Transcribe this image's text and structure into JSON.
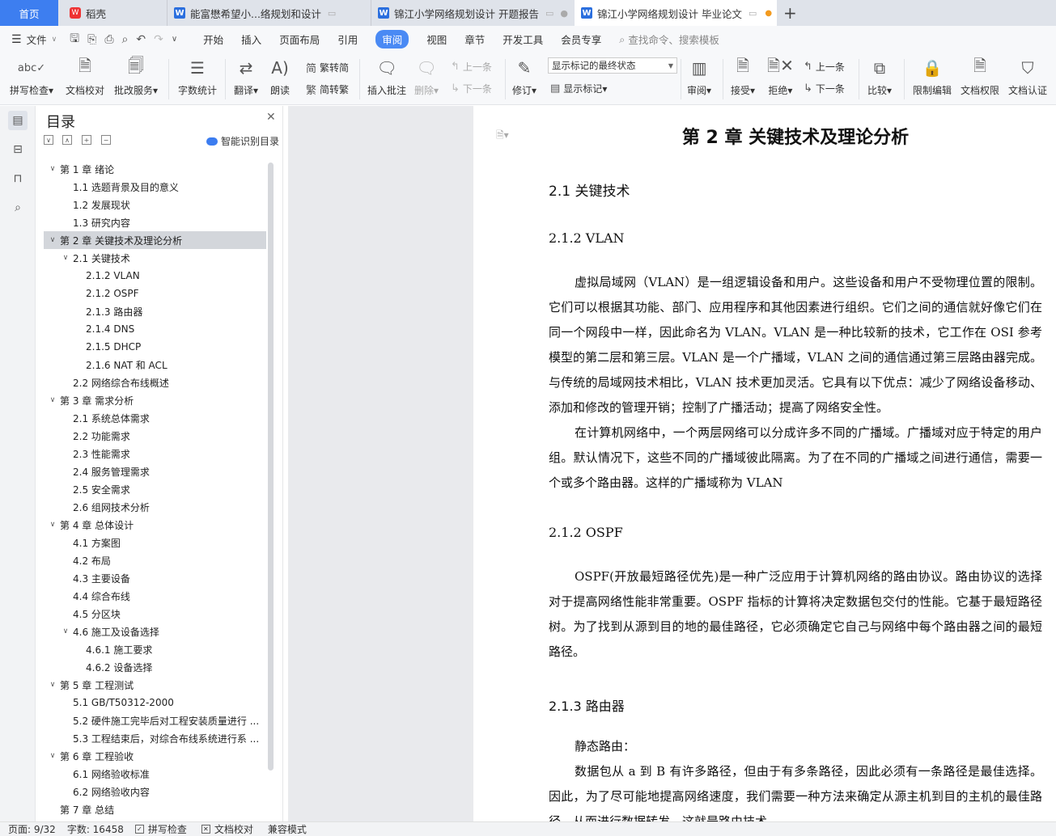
{
  "tabs": [
    {
      "label": "首页",
      "type": "home"
    },
    {
      "label": "稻壳",
      "type": "docer"
    },
    {
      "label": "能富懋希望小...络规划和设计",
      "type": "doc"
    },
    {
      "label": "锦江小学网络规划设计 开题报告",
      "type": "doc"
    },
    {
      "label": "锦江小学网络规划设计 毕业论文",
      "type": "doc"
    }
  ],
  "new_tab": "+",
  "menu": {
    "file": "文件",
    "items": [
      "开始",
      "插入",
      "页面布局",
      "引用",
      "审阅",
      "视图",
      "章节",
      "开发工具",
      "会员专享"
    ],
    "active": "审阅",
    "search_placeholder": "查找命令、搜索模板"
  },
  "ribbon": {
    "spell": "拼写检查",
    "doc_check": "文档校对",
    "batch": "批改服务",
    "word_count": "字数统计",
    "translate": "翻译",
    "read": "朗读",
    "trad": "繁转简",
    "simp": "简转繁",
    "insert_comment": "插入批注",
    "delete": "删除",
    "prev_comment": "上一条",
    "next_comment": "下一条",
    "revise": "修订",
    "markup_select": "显示标记的最终状态",
    "show_markup": "显示标记",
    "review": "审阅",
    "accept": "接受",
    "reject": "拒绝",
    "prev": "上一条",
    "next": "下一条",
    "compare": "比较",
    "restrict": "限制编辑",
    "permission": "文档权限",
    "certify": "文档认证"
  },
  "nav": {
    "title": "目录",
    "smart": "智能识别目录",
    "items": [
      {
        "text": "第 1 章  绪论",
        "level": 1,
        "arrow": true
      },
      {
        "text": "1.1  选题背景及目的意义",
        "level": 2,
        "arrow": false
      },
      {
        "text": "1.2  发展现状",
        "level": 2,
        "arrow": false
      },
      {
        "text": "1.3  研究内容",
        "level": 2,
        "arrow": false
      },
      {
        "text": "第 2 章  关键技术及理论分析",
        "level": 1,
        "arrow": true,
        "selected": true
      },
      {
        "text": "2.1  关键技术",
        "level": 2,
        "arrow": true
      },
      {
        "text": "2.1.2 VLAN",
        "level": 3,
        "arrow": false
      },
      {
        "text": "2.1.2 OSPF",
        "level": 3,
        "arrow": false
      },
      {
        "text": "2.1.3  路由器",
        "level": 3,
        "arrow": false
      },
      {
        "text": "2.1.4 DNS",
        "level": 3,
        "arrow": false
      },
      {
        "text": "2.1.5 DHCP",
        "level": 3,
        "arrow": false
      },
      {
        "text": "2.1.6 NAT 和 ACL",
        "level": 3,
        "arrow": false
      },
      {
        "text": "2.2  网络综合布线概述",
        "level": 2,
        "arrow": false
      },
      {
        "text": "第 3 章  需求分析",
        "level": 1,
        "arrow": true
      },
      {
        "text": "2.1  系统总体需求",
        "level": 2,
        "arrow": false
      },
      {
        "text": "2.2  功能需求",
        "level": 2,
        "arrow": false
      },
      {
        "text": "2.3  性能需求",
        "level": 2,
        "arrow": false
      },
      {
        "text": "2.4  服务管理需求",
        "level": 2,
        "arrow": false
      },
      {
        "text": "2.5  安全需求",
        "level": 2,
        "arrow": false
      },
      {
        "text": "2.6  组网技术分析",
        "level": 2,
        "arrow": false
      },
      {
        "text": "第 4 章  总体设计",
        "level": 1,
        "arrow": true
      },
      {
        "text": "4.1  方案图",
        "level": 2,
        "arrow": false
      },
      {
        "text": "4.2  布局",
        "level": 2,
        "arrow": false
      },
      {
        "text": "4.3  主要设备",
        "level": 2,
        "arrow": false
      },
      {
        "text": "4.4  综合布线",
        "level": 2,
        "arrow": false
      },
      {
        "text": "4.5  分区块",
        "level": 2,
        "arrow": false
      },
      {
        "text": "4.6  施工及设备选择",
        "level": 2,
        "arrow": true
      },
      {
        "text": "4.6.1  施工要求",
        "level": 3,
        "arrow": false
      },
      {
        "text": "4.6.2  设备选择",
        "level": 3,
        "arrow": false
      },
      {
        "text": "第 5 章  工程测试",
        "level": 1,
        "arrow": true
      },
      {
        "text": "5.1 GB/T50312-2000",
        "level": 2,
        "arrow": false
      },
      {
        "text": "5.2  硬件施工完毕后对工程安装质量进行 ...",
        "level": 2,
        "arrow": false
      },
      {
        "text": "5.3  工程结束后，对综合布线系统进行系 ...",
        "level": 2,
        "arrow": false
      },
      {
        "text": "第 6 章  工程验收",
        "level": 1,
        "arrow": true
      },
      {
        "text": "6.1  网络验收标准",
        "level": 2,
        "arrow": false
      },
      {
        "text": "6.2  网络验收内容",
        "level": 2,
        "arrow": false
      },
      {
        "text": "第 7 章  总结",
        "level": 1,
        "arrow": false
      }
    ]
  },
  "doc": {
    "chapter": "第 2 章  关键技术及理论分析",
    "s21": "2.1  关键技术",
    "s212a": "2.1.2 VLAN",
    "vlan_p1": "虚拟局域网（VLAN）是一组逻辑设备和用户。这些设备和用户不受物理位置的限制。它们可以根据其功能、部门、应用程序和其他因素进行组织。它们之间的通信就好像它们在同一个网段中一样，因此命名为 VLAN。VLAN 是一种比较新的技术，它工作在 OSI 参考模型的第二层和第三层。VLAN 是一个广播域，VLAN 之间的通信通过第三层路由器完成。与传统的局域网技术相比，VLAN 技术更加灵活。它具有以下优点：减少了网络设备移动、添加和修改的管理开销；控制了广播活动；提高了网络安全性。",
    "vlan_p2": "在计算机网络中，一个两层网络可以分成许多不同的广播域。广播域对应于特定的用户组。默认情况下，这些不同的广播域彼此隔离。为了在不同的广播域之间进行通信，需要一个或多个路由器。这样的广播域称为 VLAN",
    "s212b": "2.1.2 OSPF",
    "ospf_p1": "OSPF(开放最短路径优先)是一种广泛应用于计算机网络的路由协议。路由协议的选择对于提高网络性能非常重要。OSPF 指标的计算将决定数据包交付的性能。它基于最短路径树。为了找到从源到目的地的最佳路径，它必须确定它自己与网络中每个路由器之间的最短路径。",
    "s213": "2.1.3  路由器",
    "router_p1": "静态路由：",
    "router_p2": "数据包从 a 到 B 有许多路径，但由于有多条路径，因此必须有一条路径是最佳选择。因此，为了尽可能地提高网络速度，我们需要一种方法来确定从源主机到目的主机的最佳路径，从而进行数据转发，这就是路由技术。"
  },
  "status": {
    "page": "页面: 9/32",
    "words": "字数: 16458",
    "spell": "拼写检查",
    "doccheck": "文档校对",
    "compat": "兼容模式"
  }
}
